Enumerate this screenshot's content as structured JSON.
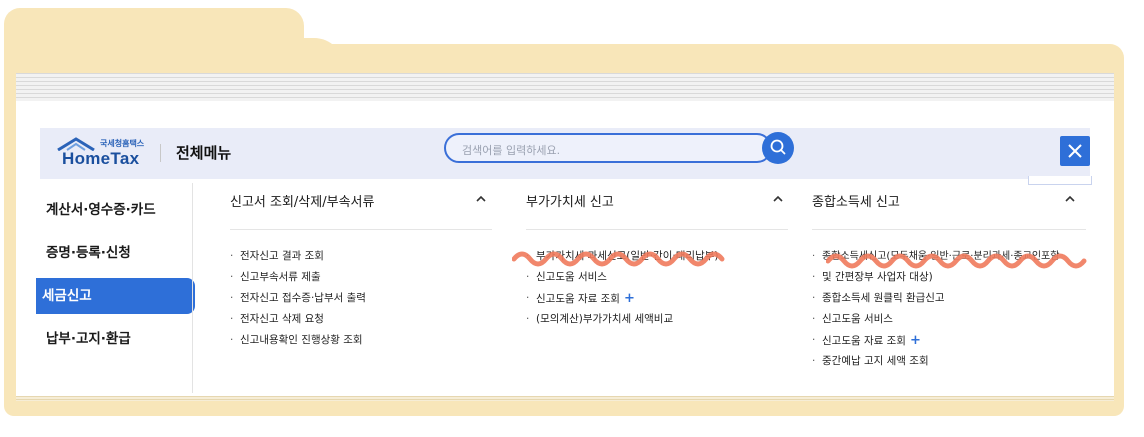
{
  "header": {
    "logo_small": "국세청홈택스",
    "logo_main": "HomeTax",
    "menu_title": "전체메뉴",
    "search_placeholder": "검색어를 입력하세요."
  },
  "sidebar": {
    "items": [
      {
        "label": "계산서·영수증·카드"
      },
      {
        "label": "증명·등록·신청"
      },
      {
        "label": "세금신고"
      },
      {
        "label": "납부·고지·환급"
      }
    ],
    "active_index": 2
  },
  "columns": [
    {
      "title": "신고서 조회/삭제/부속서류",
      "items": [
        {
          "label": "전자신고 결과 조회"
        },
        {
          "label": "신고부속서류 제출"
        },
        {
          "label": "전자신고 접수증·납부서 출력"
        },
        {
          "label": "전자신고 삭제 요청"
        },
        {
          "label": "신고내용확인 진행상황 조회"
        }
      ]
    },
    {
      "title": "부가가치세 신고",
      "items": [
        {
          "label": "부가가치세 과세신고(일반·간이·대리납부)"
        },
        {
          "label": "신고도움 서비스"
        },
        {
          "label": "신고도움 자료 조회",
          "plus": "+"
        },
        {
          "label": "(모의계산)부가가치세 세액비교"
        }
      ]
    },
    {
      "title": "종합소득세 신고",
      "items": [
        {
          "label": "종합소득세신고(모두채움·일반·근로·분리과세·종교인포함"
        },
        {
          "label": "및 간편장부 사업자 대상)"
        },
        {
          "label": "종합소득세 원클릭 환급신고"
        },
        {
          "label": "신고도움 서비스"
        },
        {
          "label": "신고도움 자료 조회",
          "plus": "+"
        },
        {
          "label": "중간예납 고지 세액 조회"
        }
      ]
    }
  ],
  "colors": {
    "accent": "#2e6fd8",
    "folder": "#f8e6b9",
    "header_bg": "#e9ecf8",
    "scribble": "#f07a5c"
  }
}
